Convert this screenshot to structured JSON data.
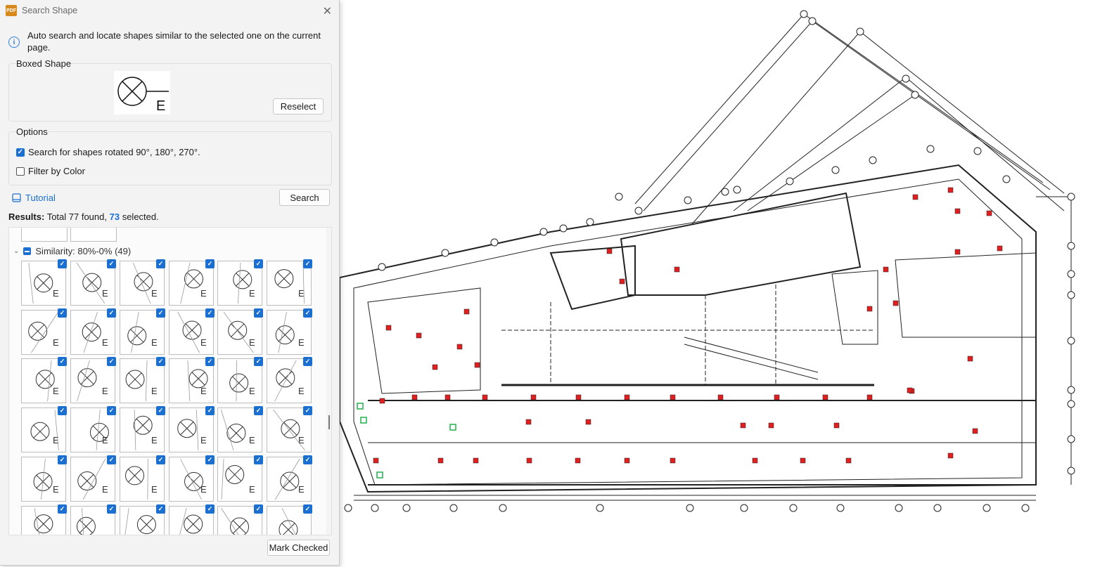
{
  "dialog": {
    "title": "Search Shape",
    "app_icon_text": "PDF",
    "info_text": "Auto search and locate shapes similar to the selected one on the current page.",
    "boxed_shape_label": "Boxed Shape",
    "reselect_label": "Reselect",
    "options_label": "Options",
    "option_rotated_label": "Search for shapes rotated 90°, 180°, 270°.",
    "option_rotated_checked": true,
    "option_color_label": "Filter by Color",
    "option_color_checked": false,
    "tutorial_label": "Tutorial",
    "search_label": "Search",
    "results_prefix": "Results:",
    "results_total": "Total 77 found,",
    "results_selected": "73",
    "results_suffix": "selected.",
    "similarity_group_label": "Similarity: 80%-0% (49)",
    "mark_checked_label": "Mark Checked",
    "preview_letter": "E"
  },
  "colors": {
    "accent": "#1a6fd0",
    "marker_red": "#e02020",
    "marker_green": "#22b14c"
  },
  "icons": {
    "app": "pdf-app-icon",
    "close": "close-icon",
    "info": "info-icon",
    "tutorial": "book-icon",
    "collapse": "chevron-down-icon"
  }
}
